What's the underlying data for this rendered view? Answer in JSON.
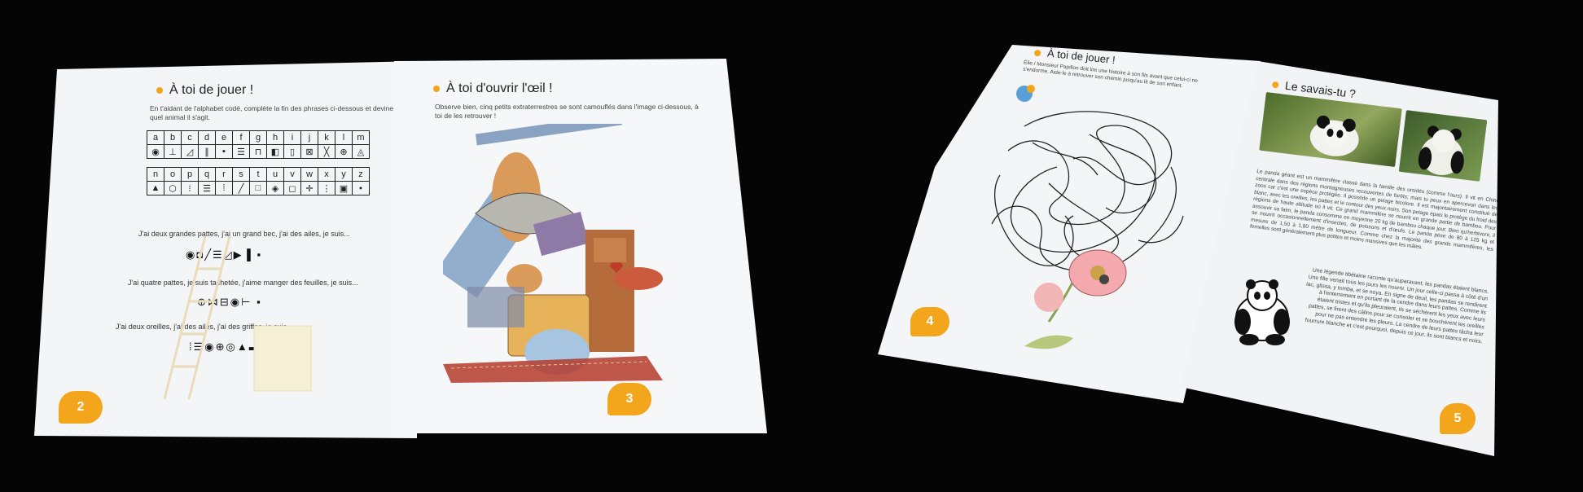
{
  "booklet_left": {
    "page2": {
      "title": "À toi de jouer !",
      "instructions": "En t'aidant de l'alphabet codé, complète la fin des phrases ci-dessous et devine de quel animal il s'agit.",
      "alphabet_row1": [
        "a",
        "b",
        "c",
        "d",
        "e",
        "f",
        "g",
        "h",
        "i",
        "j",
        "k",
        "l",
        "m"
      ],
      "alphabet_row2": [
        "n",
        "o",
        "p",
        "q",
        "r",
        "s",
        "t",
        "u",
        "v",
        "w",
        "x",
        "y",
        "z"
      ],
      "riddle1": "J'ai deux grandes pattes, j'ai un grand bec, j'ai des ailes, je suis...",
      "riddle2": "J'ai quatre pattes, je suis tachetée, j'aime manger des feuilles, je suis...",
      "riddle3": "J'ai deux oreilles, j'ai des ailes, j'ai des griffes, je suis...",
      "page_number": "2"
    },
    "page3": {
      "title": "À toi d'ouvrir l'œil !",
      "instructions": "Observe bien, cinq petits extraterrestres se sont camouflés dans l'image ci-dessous, à toi de les retrouver !",
      "page_number": "3"
    }
  },
  "booklet_right": {
    "page4": {
      "title": "À toi de jouer !",
      "instructions": "Élie / Monsieur Papillon doit lire une histoire à son fils avant que celui-ci ne s'endorme. Aide-le à retrouver son chemin jusqu'au lit de son enfant.",
      "page_number": "4"
    },
    "page5": {
      "title": "Le savais-tu ?",
      "paragraph1": "Le panda géant est un mammifère classé dans la famille des ursidés (comme l'ours). Il vit en Chine centrale dans des régions montagneuses recouvertes de forêts; mais tu peux en apercevoir dans les zoos car c'est une espèce protégée. Il possède un pelage bicolore. Il est majoritairement constitué de blanc, avec les oreilles, les pattes et le contour des yeux noirs. Son pelage épais le protège du froid des régions de haute altitude où il vit. Ce grand mammifère se nourrit en grande partie de bambou. Pour assouvir sa faim, le panda consomme en moyenne 20 kg de bambou chaque jour. Bien qu'herbivore, il se nourrit occasionnellement d'insectes, de poissons et d'œufs. Le panda pèse de 80 à 125 kg et mesure de 1,50 à 1,80 mètre de longueur. Comme chez la majorité des grands mammifères, les femelles sont généralement plus petites et moins massives que les mâles.",
      "legend": "Une légende tibétaine raconte qu'auparavant, les pandas étaient blancs. Une fille venait tous les jours les nourrir. Un jour celle-ci passa à côté d'un lac, glissa, y tomba, et se noya. En signe de deuil, les pandas se rendirent à l'enterrement en portant de la cendre dans leurs pattes. Comme ils étaient tristes et qu'ils pleuraient, ils se séchèrent les yeux avec leurs pattes, se firent des câlins pour se consoler et se bouchèrent les oreilles pour ne pas entendre les pleurs. La cendre de leurs pattes tâcha leur fourrure blanche et c'est pourquoi, depuis ce jour, ils sont blancs et noirs.",
      "page_number": "5"
    }
  },
  "colors": {
    "accent": "#f3a51c",
    "background": "#050505",
    "paper": "#f4f5f7"
  }
}
